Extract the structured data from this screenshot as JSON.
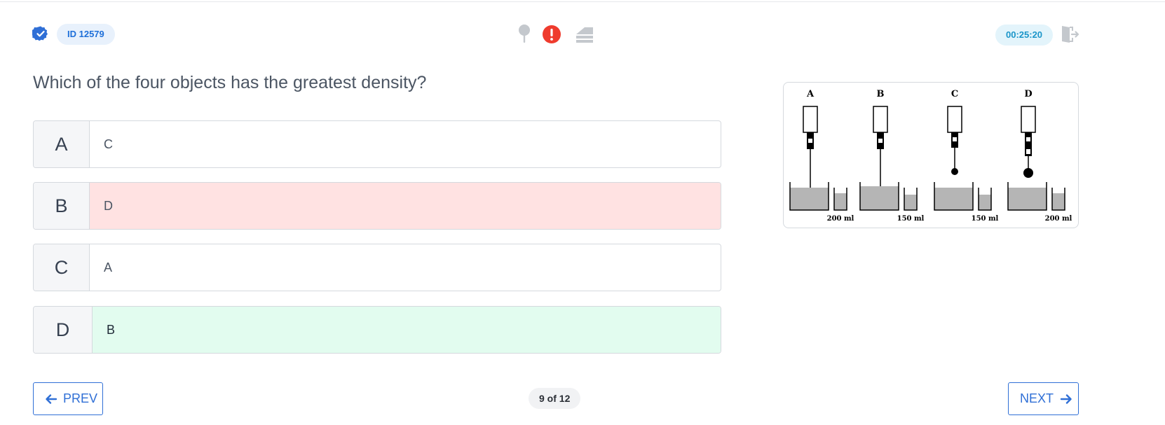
{
  "header": {
    "question_id": "ID 12579",
    "timer": "00:25:20",
    "icons": [
      "verified-badge-icon",
      "pin-icon",
      "alert-icon",
      "eraser-icon",
      "exit-icon"
    ]
  },
  "question": {
    "text": "Which of the four objects has the greatest density?"
  },
  "options": [
    {
      "letter": "A",
      "text": "C",
      "state": "default"
    },
    {
      "letter": "B",
      "text": "D",
      "state": "wrong"
    },
    {
      "letter": "C",
      "text": "A",
      "state": "default"
    },
    {
      "letter": "D",
      "text": "B",
      "state": "correct"
    }
  ],
  "figure": {
    "labels": [
      "A",
      "B",
      "C",
      "D"
    ],
    "volumes": [
      "200 ml",
      "150 ml",
      "150 ml",
      "200 ml"
    ]
  },
  "footer": {
    "prev_label": "PREV",
    "next_label": "NEXT",
    "page_indicator": "9 of 12"
  },
  "colors": {
    "accent": "#2f6fd6",
    "wrong_bg": "#ffe2e2",
    "correct_bg": "#e2fcef",
    "alert": "#ef3b2d"
  }
}
